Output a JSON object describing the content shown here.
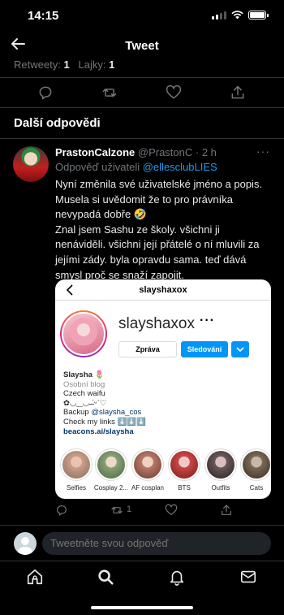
{
  "status_bar": {
    "time": "14:15"
  },
  "header": {
    "title": "Tweet"
  },
  "stats": {
    "retweets_label": "Retweety:",
    "retweets": "1",
    "likes_label": "Lajky:",
    "likes": "1"
  },
  "section_title": "Další odpovědi",
  "reply": {
    "author_name": "PrastonCalzone",
    "author_handle": "@PrastonC",
    "time": "· 2 h",
    "reply_to_label": "Odpověď uživateli",
    "reply_to_handle": "@ellesclubLIES",
    "text": "Nyní změnila své uživatelské jméno a popis.\nMusela si uvědomit že to pro právníka nevypadá dobře 🤣\nZnal jsem Sashu ze školy. všichni ji nenáviděli. všichni její přátelé o ní mluvili za jejími zády. byla opravdu sama. teď dává smysl proč se snaží zapojit.",
    "retweet_count": "1"
  },
  "embed": {
    "top_name": "slayshaxox",
    "username": "slayshaxox",
    "message_button": "Zpráva",
    "follow_button": "Sledování",
    "bio": {
      "name": "Slaysha 🌷",
      "category": "Osobní blog",
      "line1": "Czech waifu",
      "line2": "✿◡‿◡ ̶̶̶̶̶̶ˊᵕˋ♡",
      "backup_label": "Backup",
      "backup_handle": "@slaysha_cos",
      "links_line": "Check my links ⬇️⬇️⬇️",
      "url": "beacons.ai/slaysha"
    },
    "highlights": [
      {
        "label": "Selfies",
        "color": "#c9a08a"
      },
      {
        "label": "Cosplay 2...",
        "color": "#8aa07a"
      },
      {
        "label": "AF cosplan",
        "color": "#b87a6a"
      },
      {
        "label": "BTS",
        "color": "#c94848"
      },
      {
        "label": "Outfits",
        "color": "#6a5a5a"
      },
      {
        "label": "Cats",
        "color": "#7a6a5a"
      }
    ]
  },
  "compose": {
    "placeholder": "Tweetněte svou odpověď"
  },
  "icons": {
    "back": "back-arrow-icon",
    "reply": "reply-icon",
    "retweet": "retweet-icon",
    "like": "heart-icon",
    "share": "share-icon",
    "home": "home-icon",
    "search": "search-icon",
    "notifications": "bell-icon",
    "messages": "mail-icon"
  },
  "colors": {
    "accent": "#1d9bf0",
    "background": "#000000",
    "instagram_blue": "#0095f6"
  }
}
